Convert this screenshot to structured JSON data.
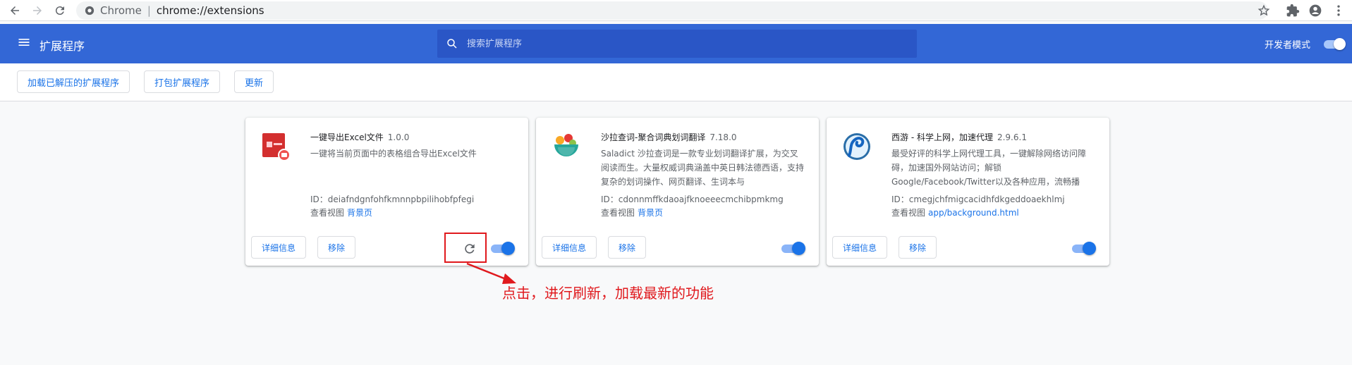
{
  "browser": {
    "origin": "Chrome",
    "url": "chrome://extensions"
  },
  "header": {
    "title": "扩展程序",
    "search_placeholder": "搜索扩展程序",
    "dev_mode_label": "开发者模式",
    "dev_mode_on": true
  },
  "toolbar": {
    "load_unpacked": "加载已解压的扩展程序",
    "pack": "打包扩展程序",
    "update": "更新"
  },
  "card_buttons": {
    "details": "详细信息",
    "remove": "移除",
    "views_label": "查看视图"
  },
  "extensions": [
    {
      "name": "一键导出Excel文件",
      "version": "1.0.0",
      "description": "一键将当前页面中的表格组合导出Excel文件",
      "id": "ID：deiafndgnfohfkmnnpbpilihobfpfegi",
      "view_link": "背景页",
      "enabled": true,
      "has_reload": true,
      "icon": "excel-export-icon"
    },
    {
      "name": "沙拉查词-聚合词典划词翻译",
      "version": "7.18.0",
      "description": "Saladict 沙拉查词是一款专业划词翻译扩展，为交叉阅读而生。大量权威词典涵盖中英日韩法德西语，支持复杂的划词操作、网页翻译、生词本与",
      "id": "ID：cdonnmffkdaoajfknoeeecmchibpmkmg",
      "view_link": "背景页",
      "enabled": true,
      "has_reload": false,
      "icon": "saladict-bowl-icon"
    },
    {
      "name": "西游 - 科学上网，加速代理",
      "version": "2.9.6.1",
      "description": "最受好评的科学上网代理工具，一键解除网络访问障碍，加速国外网站访问；解锁Google/Facebook/Twitter以及各种应用，流畅播",
      "id": "ID：cmegjchfmigcacidhfdkgeddoaekhlmj",
      "view_link": "app/background.html",
      "enabled": true,
      "has_reload": false,
      "icon": "xiyou-wave-icon"
    }
  ],
  "annotation": {
    "text": "点击，进行刷新，加载最新的功能",
    "color": "#e0191d"
  },
  "colors": {
    "header_blue": "#3367d6",
    "link_blue": "#1a73e8"
  }
}
